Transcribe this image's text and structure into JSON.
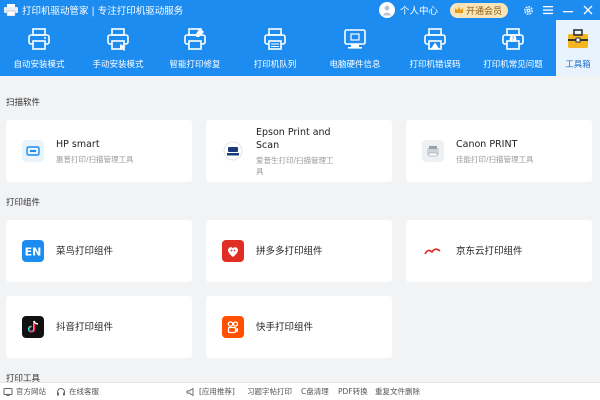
{
  "title": {
    "app_title": "打印机驱动管家 | 专注打印机驱动服务",
    "user_center": "个人中心",
    "vip_button": "开通会员"
  },
  "toolbar": {
    "items": [
      {
        "label": "自动安装模式",
        "icon": "printer-auto-icon"
      },
      {
        "label": "手动安装模式",
        "icon": "printer-manual-icon"
      },
      {
        "label": "智能打印修复",
        "icon": "printer-repair-icon"
      },
      {
        "label": "打印机队列",
        "icon": "printer-queue-icon"
      },
      {
        "label": "电脑硬件信息",
        "icon": "hardware-info-icon"
      },
      {
        "label": "打印机错误码",
        "icon": "printer-error-icon"
      },
      {
        "label": "打印机常见问题",
        "icon": "printer-faq-icon"
      },
      {
        "label": "工具箱",
        "icon": "toolbox-icon",
        "active": true
      }
    ]
  },
  "sections": {
    "scan": {
      "title": "扫描软件",
      "cards": [
        {
          "name": "HP smart",
          "desc": "惠普打印/扫描管理工具",
          "icon": "hp-smart-icon"
        },
        {
          "name": "Epson Print and Scan",
          "desc": "爱普生打印/扫描管理工具",
          "icon": "epson-icon"
        },
        {
          "name": "Canon PRINT",
          "desc": "佳能打印/扫描管理工具",
          "icon": "canon-print-icon"
        }
      ]
    },
    "print": {
      "title": "打印组件",
      "cards": [
        {
          "name": "菜鸟打印组件",
          "icon": "cainiao-icon"
        },
        {
          "name": "拼多多打印组件",
          "icon": "pinduoduo-icon"
        },
        {
          "name": "京东云打印组件",
          "icon": "jd-cloud-icon"
        },
        {
          "name": "抖音打印组件",
          "icon": "douyin-icon"
        },
        {
          "name": "快手打印组件",
          "icon": "kuaishou-icon"
        }
      ]
    },
    "tools": {
      "title": "打印工具"
    }
  },
  "footer": {
    "website": "官方网站",
    "support": "在线客服",
    "recommend": "[应用推荐]",
    "practice": "习题字帖打印",
    "cleanup": "C盘清理",
    "pdf": "PDF转换",
    "dedupe": "重复文件删除"
  },
  "colors": {
    "accent": "#1d8cf0",
    "background": "#f2f3f5",
    "card": "#ffffff"
  }
}
